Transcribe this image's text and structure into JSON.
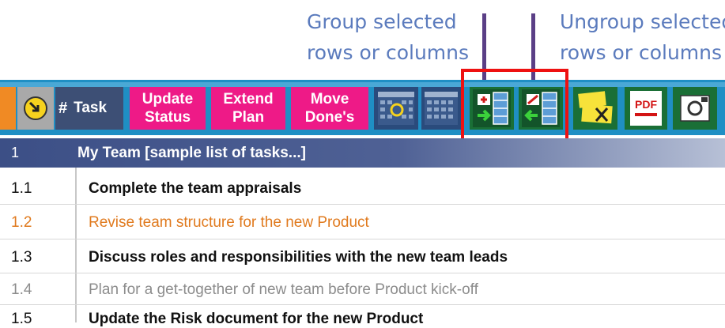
{
  "annotations": {
    "group_line1": "Group selected",
    "group_line2": "rows or columns",
    "ungroup_line1": "Ungroup selected",
    "ungroup_line2": "rows or columns"
  },
  "toolbar": {
    "hash_label": "#",
    "task_label": "Task",
    "update_status_line1": "Update",
    "update_status_line2": "Status",
    "extend_plan_line1": "Extend",
    "extend_plan_line2": "Plan",
    "move_done_line1": "Move",
    "move_done_line2": "Done's",
    "pdf_label": "PDF"
  },
  "group_row": {
    "number": "1",
    "title": "My Team [sample list of tasks...]"
  },
  "tasks": [
    {
      "number": "1.1",
      "title": "Complete the team appraisals",
      "color": "#111111",
      "bold": true
    },
    {
      "number": "1.2",
      "title": "Revise team structure for the new Product",
      "color": "#e07a1e",
      "bold": false
    },
    {
      "number": "1.3",
      "title": "Discuss roles and responsibilities with the new team leads",
      "color": "#111111",
      "bold": true
    },
    {
      "number": "1.4",
      "title": "Plan for a get-together of new team before Product kick-off",
      "color": "#8c8c8c",
      "bold": false
    },
    {
      "number": "1.5",
      "title": "Update the Risk document for the new Product",
      "color": "#111111",
      "bold": true
    }
  ],
  "colors": {
    "toolbar_blue": "#1f8fc4",
    "button_pink": "#ee1a87",
    "group_row_start": "#3c4f86",
    "highlight_red": "#ee1111",
    "annotation_blue": "#5b7bbd"
  }
}
